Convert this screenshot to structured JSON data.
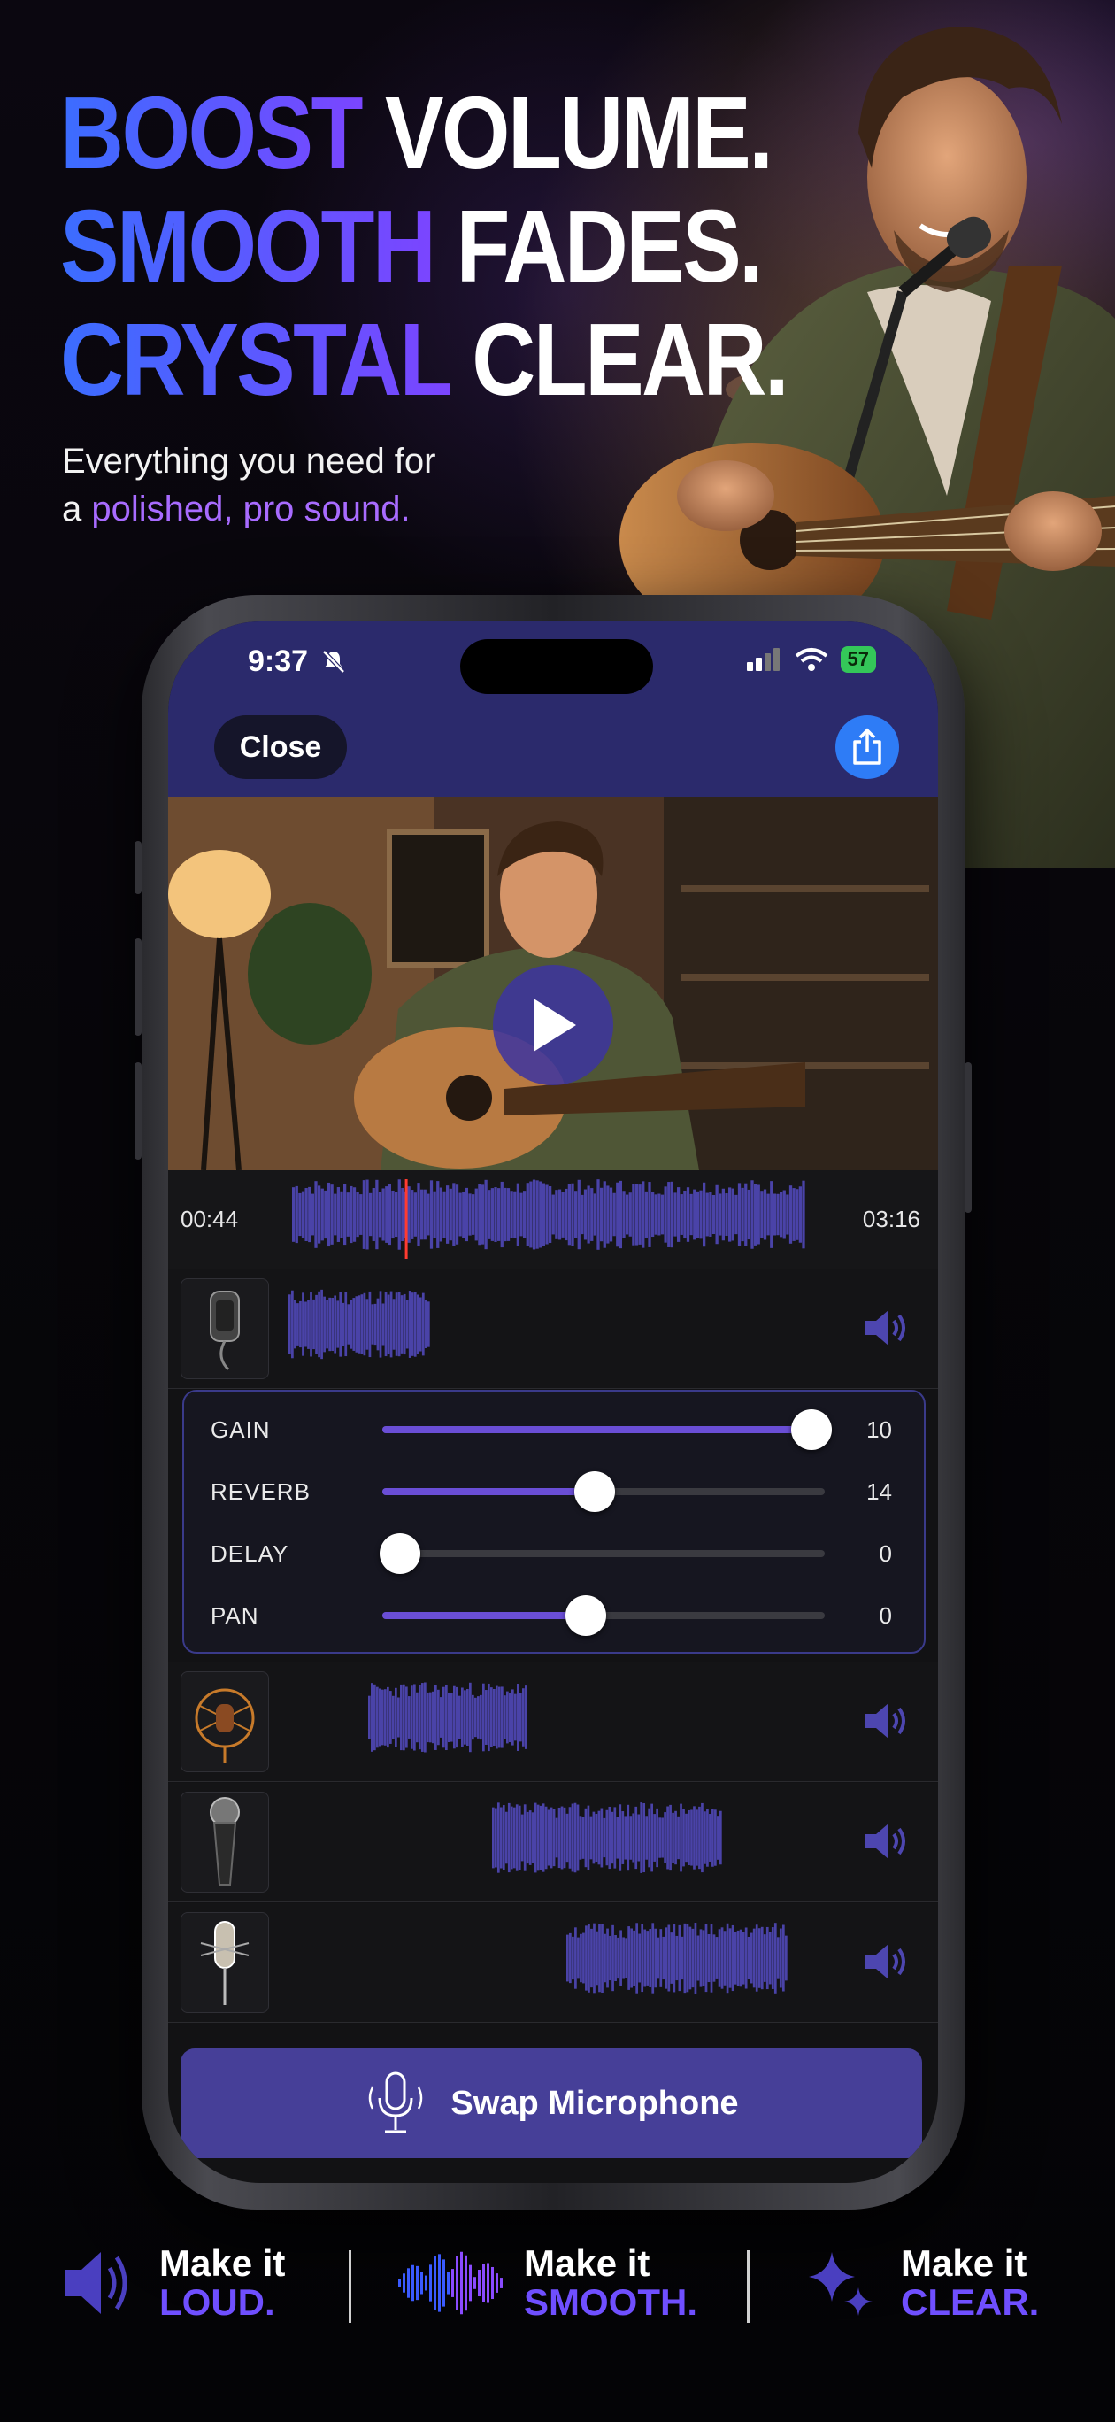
{
  "headline": {
    "line1": {
      "accent": "BOOST",
      "rest": "VOLUME."
    },
    "line2": {
      "accent": "SMOOTH",
      "rest": "FADES."
    },
    "line3": {
      "accent": "CRYSTAL",
      "rest": "CLEAR."
    }
  },
  "subtitle": {
    "line1": "Everything you need for",
    "line2_prefix": "a",
    "line2_accent": "polished, pro sound."
  },
  "status_bar": {
    "time": "9:37",
    "battery": "57"
  },
  "toolbar": {
    "close_label": "Close"
  },
  "timeline": {
    "current_time": "00:44",
    "total_time": "03:16",
    "playhead_fraction": 0.22
  },
  "effects": [
    {
      "label": "GAIN",
      "value": "10",
      "level": 0.97
    },
    {
      "label": "REVERB",
      "value": "14",
      "level": 0.48
    },
    {
      "label": "DELAY",
      "value": "0",
      "level": 0.04
    },
    {
      "label": "PAN",
      "value": "0",
      "level": 0.46
    }
  ],
  "tracks": [
    {
      "icon": "lavalier-mic-icon"
    },
    {
      "icon": "condenser-mic-icon"
    },
    {
      "icon": "handheld-mic-icon"
    },
    {
      "icon": "studio-mic-icon"
    }
  ],
  "swap_button": {
    "label": "Swap Microphone"
  },
  "features": [
    {
      "icon": "speaker-icon",
      "line1": "Make it",
      "line2": "LOUD."
    },
    {
      "icon": "waveform-icon",
      "line1": "Make it",
      "line2": "SMOOTH."
    },
    {
      "icon": "sparkles-icon",
      "line1": "Make it",
      "line2": "CLEAR."
    }
  ],
  "colors": {
    "accent": "#6f4fff",
    "topbar": "#2b2a6c",
    "waveform": "#4a43a8",
    "button": "#463f98",
    "playhead": "#ff3b30"
  }
}
